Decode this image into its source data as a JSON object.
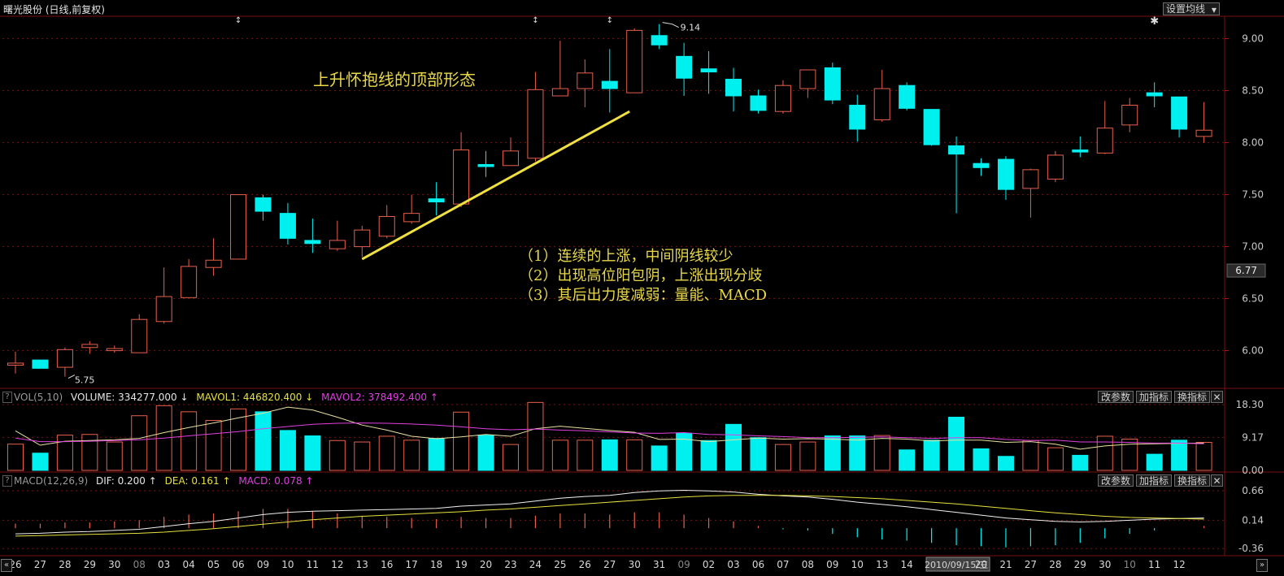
{
  "header": {
    "title": "曙光股份 (日线,前复权)",
    "setting_button": "设置均线",
    "setting_caret": "▼"
  },
  "annotations": {
    "title": "上升怀抱线的顶部形态",
    "notes": [
      "（1）连续的上涨，中间阴线较少",
      "（2）出现高位阳包阴，上涨出现分歧",
      "（3）其后出力度减弱：量能、MACD"
    ]
  },
  "markers": {
    "high_label": "9.14",
    "low_label": "5.75",
    "current_price": "6.77",
    "date_highlight": "2010/09/15/三"
  },
  "vol_panel": {
    "q": "?",
    "name": "VOL(5,10)",
    "volume": "VOLUME: 334277.000",
    "volume_arrow": "↓",
    "mavol1": "MAVOL1: 446820.400",
    "mavol1_arrow": "↓",
    "mavol2": "MAVOL2: 378492.400",
    "mavol2_arrow": "↑",
    "btn_params": "改参数",
    "btn_add": "加指标",
    "btn_switch": "换指标",
    "btn_close": "✕"
  },
  "macd_panel": {
    "q": "?",
    "name": "MACD(12,26,9)",
    "dif": "DIF: 0.200",
    "dif_arrow": "↑",
    "dea": "DEA: 0.161",
    "dea_arrow": "↑",
    "macd": "MACD: 0.078",
    "macd_arrow": "↑",
    "btn_params": "改参数",
    "btn_add": "加指标",
    "btn_switch": "换指标",
    "btn_close": "✕"
  },
  "colors": {
    "up": "#e8604c",
    "down": "#00f0f0",
    "trend": "#f0e040",
    "ma1": "#e8e0a0",
    "ma2": "#e040e0",
    "dif": "#f0f0f0",
    "dea": "#e8e040",
    "grid": "#7a1010"
  },
  "chart_data": {
    "type": "candlestick",
    "price_axis": {
      "ticks": [
        "9.00",
        "8.50",
        "8.00",
        "7.50",
        "7.00",
        "6.50",
        "6.00"
      ],
      "range": [
        5.7,
        9.2
      ]
    },
    "x_labels": [
      "26",
      "27",
      "28",
      "29",
      "30",
      "08",
      "03",
      "04",
      "05",
      "06",
      "09",
      "10",
      "11",
      "12",
      "13",
      "16",
      "17",
      "18",
      "19",
      "20",
      "23",
      "24",
      "25",
      "26",
      "27",
      "30",
      "31",
      "09",
      "02",
      "03",
      "06",
      "07",
      "08",
      "09",
      "10",
      "13",
      "14",
      "15",
      "2010/09/15/三",
      "20",
      "21",
      "27",
      "28",
      "29",
      "30",
      "10",
      "11",
      "12"
    ],
    "candles": [
      {
        "o": 5.86,
        "c": 5.88,
        "h": 5.99,
        "l": 5.78
      },
      {
        "o": 5.91,
        "c": 5.83,
        "h": 5.91,
        "l": 5.83
      },
      {
        "o": 5.84,
        "c": 6.01,
        "h": 6.03,
        "l": 5.75
      },
      {
        "o": 6.03,
        "c": 6.06,
        "h": 6.09,
        "l": 5.97
      },
      {
        "o": 6.0,
        "c": 6.02,
        "h": 6.05,
        "l": 5.98
      },
      {
        "o": 5.98,
        "c": 6.3,
        "h": 6.35,
        "l": 5.98
      },
      {
        "o": 6.28,
        "c": 6.52,
        "h": 6.8,
        "l": 6.26
      },
      {
        "o": 6.51,
        "c": 6.81,
        "h": 6.88,
        "l": 6.51
      },
      {
        "o": 6.8,
        "c": 6.87,
        "h": 7.08,
        "l": 6.72
      },
      {
        "o": 6.88,
        "c": 7.5,
        "h": 7.5,
        "l": 6.88
      },
      {
        "o": 7.47,
        "c": 7.34,
        "h": 7.5,
        "l": 7.25
      },
      {
        "o": 7.32,
        "c": 7.08,
        "h": 7.42,
        "l": 7.02
      },
      {
        "o": 7.06,
        "c": 7.03,
        "h": 7.27,
        "l": 6.94
      },
      {
        "o": 6.98,
        "c": 7.06,
        "h": 7.25,
        "l": 6.96
      },
      {
        "o": 7.0,
        "c": 7.16,
        "h": 7.2,
        "l": 6.9
      },
      {
        "o": 7.1,
        "c": 7.29,
        "h": 7.4,
        "l": 7.08
      },
      {
        "o": 7.24,
        "c": 7.32,
        "h": 7.5,
        "l": 7.22
      },
      {
        "o": 7.46,
        "c": 7.43,
        "h": 7.62,
        "l": 7.3
      },
      {
        "o": 7.41,
        "c": 7.93,
        "h": 8.1,
        "l": 7.38
      },
      {
        "o": 7.79,
        "c": 7.77,
        "h": 7.92,
        "l": 7.67
      },
      {
        "o": 7.78,
        "c": 7.92,
        "h": 8.05,
        "l": 7.78
      },
      {
        "o": 7.85,
        "c": 8.51,
        "h": 8.68,
        "l": 7.82
      },
      {
        "o": 8.45,
        "c": 8.52,
        "h": 8.98,
        "l": 8.45
      },
      {
        "o": 8.52,
        "c": 8.67,
        "h": 8.8,
        "l": 8.34
      },
      {
        "o": 8.59,
        "c": 8.52,
        "h": 8.9,
        "l": 8.29
      },
      {
        "o": 8.48,
        "c": 9.08,
        "h": 9.1,
        "l": 8.48
      },
      {
        "o": 9.03,
        "c": 8.94,
        "h": 9.14,
        "l": 8.9
      },
      {
        "o": 8.83,
        "c": 8.62,
        "h": 8.96,
        "l": 8.45
      },
      {
        "o": 8.71,
        "c": 8.68,
        "h": 8.88,
        "l": 8.47
      },
      {
        "o": 8.61,
        "c": 8.45,
        "h": 8.72,
        "l": 8.3
      },
      {
        "o": 8.45,
        "c": 8.31,
        "h": 8.51,
        "l": 8.28
      },
      {
        "o": 8.3,
        "c": 8.55,
        "h": 8.6,
        "l": 8.28
      },
      {
        "o": 8.52,
        "c": 8.7,
        "h": 8.7,
        "l": 8.43
      },
      {
        "o": 8.72,
        "c": 8.41,
        "h": 8.77,
        "l": 8.37
      },
      {
        "o": 8.36,
        "c": 8.13,
        "h": 8.46,
        "l": 8.01
      },
      {
        "o": 8.22,
        "c": 8.52,
        "h": 8.7,
        "l": 8.2
      },
      {
        "o": 8.55,
        "c": 8.33,
        "h": 8.58,
        "l": 8.31
      },
      {
        "o": 8.32,
        "c": 7.98,
        "h": 8.32,
        "l": 7.97
      },
      {
        "o": 7.97,
        "c": 7.89,
        "h": 8.06,
        "l": 7.32
      },
      {
        "o": 7.8,
        "c": 7.76,
        "h": 7.85,
        "l": 7.68
      },
      {
        "o": 7.84,
        "c": 7.55,
        "h": 7.87,
        "l": 7.45
      },
      {
        "o": 7.56,
        "c": 7.74,
        "h": 7.75,
        "l": 7.28
      },
      {
        "o": 7.65,
        "c": 7.88,
        "h": 7.92,
        "l": 7.62
      },
      {
        "o": 7.93,
        "c": 7.91,
        "h": 8.06,
        "l": 7.86
      },
      {
        "o": 7.9,
        "c": 8.14,
        "h": 8.4,
        "l": 7.89
      },
      {
        "o": 8.17,
        "c": 8.36,
        "h": 8.43,
        "l": 8.1
      },
      {
        "o": 8.48,
        "c": 8.45,
        "h": 8.58,
        "l": 8.34
      },
      {
        "o": 8.44,
        "c": 8.13,
        "h": 8.44,
        "l": 8.05
      },
      {
        "o": 8.06,
        "c": 8.12,
        "h": 8.39,
        "l": 8.0
      }
    ],
    "volume_axis": {
      "ticks": [
        "18.30",
        "9.17",
        "0.00"
      ],
      "range": [
        0,
        18.3
      ]
    },
    "volume": [
      7.3,
      4.8,
      9.8,
      10.0,
      7.9,
      15.2,
      18.0,
      16.3,
      13.9,
      17.1,
      16.3,
      11.1,
      9.6,
      8.3,
      7.9,
      9.5,
      8.4,
      8.9,
      16.2,
      9.8,
      7.2,
      18.9,
      8.4,
      8.4,
      8.5,
      8.5,
      6.8,
      10.3,
      8.3,
      12.8,
      9.1,
      7.2,
      7.9,
      9.6,
      9.6,
      9.7,
      5.7,
      8.4,
      14.8,
      6.0,
      3.9,
      8.3,
      6.3,
      4.2,
      9.5,
      8.7,
      4.5,
      8.4,
      7.8
    ],
    "ma_vol1": [
      11.0,
      7.0,
      8.1,
      8.3,
      8.5,
      8.9,
      10.5,
      11.9,
      13.2,
      14.6,
      15.9,
      17.6,
      16.8,
      14.8,
      12.6,
      11.2,
      9.5,
      8.8,
      9.3,
      10.0,
      9.5,
      11.6,
      12.3,
      11.7,
      11.1,
      10.6,
      8.6,
      8.7,
      8.0,
      8.5,
      9.0,
      8.7,
      8.8,
      8.7,
      8.4,
      8.9,
      8.7,
      8.2,
      8.4,
      8.4,
      7.8,
      8.0,
      7.3,
      5.9,
      6.8,
      7.3,
      7.4,
      7.5,
      7.6
    ],
    "ma_vol2": [
      9.0,
      8.0,
      8.0,
      8.1,
      8.3,
      8.5,
      9.0,
      9.6,
      10.2,
      10.8,
      11.6,
      12.2,
      12.8,
      13.1,
      13.2,
      13.1,
      12.9,
      12.6,
      12.1,
      11.6,
      11.3,
      11.5,
      11.2,
      11.0,
      10.7,
      10.4,
      10.3,
      10.5,
      10.0,
      9.9,
      9.6,
      9.4,
      9.1,
      9.1,
      9.2,
      9.3,
      9.1,
      8.9,
      9.1,
      9.1,
      8.6,
      8.3,
      8.4,
      7.9,
      7.9,
      7.8,
      7.6,
      7.6,
      7.4
    ],
    "macd_axis": {
      "ticks": [
        "0.66",
        "0.14",
        "-0.36"
      ],
      "range": [
        -0.4,
        0.72
      ]
    },
    "dif": [
      -0.1,
      -0.09,
      -0.07,
      -0.06,
      -0.04,
      -0.02,
      0.03,
      0.08,
      0.12,
      0.18,
      0.24,
      0.28,
      0.3,
      0.31,
      0.32,
      0.33,
      0.34,
      0.35,
      0.39,
      0.41,
      0.43,
      0.48,
      0.53,
      0.56,
      0.58,
      0.63,
      0.66,
      0.67,
      0.66,
      0.64,
      0.6,
      0.57,
      0.55,
      0.51,
      0.46,
      0.42,
      0.38,
      0.33,
      0.28,
      0.23,
      0.18,
      0.15,
      0.12,
      0.11,
      0.12,
      0.14,
      0.16,
      0.17,
      0.18
    ],
    "dea": [
      -0.14,
      -0.13,
      -0.12,
      -0.11,
      -0.1,
      -0.09,
      -0.07,
      -0.04,
      -0.01,
      0.03,
      0.07,
      0.11,
      0.15,
      0.18,
      0.21,
      0.23,
      0.25,
      0.27,
      0.29,
      0.32,
      0.34,
      0.37,
      0.4,
      0.43,
      0.46,
      0.49,
      0.52,
      0.55,
      0.57,
      0.58,
      0.58,
      0.58,
      0.57,
      0.56,
      0.54,
      0.52,
      0.49,
      0.46,
      0.43,
      0.39,
      0.35,
      0.31,
      0.27,
      0.24,
      0.21,
      0.19,
      0.18,
      0.17,
      0.16
    ],
    "macd": [
      0.08,
      0.08,
      0.1,
      0.1,
      0.12,
      0.14,
      0.2,
      0.24,
      0.26,
      0.3,
      0.34,
      0.34,
      0.3,
      0.26,
      0.22,
      0.2,
      0.18,
      0.16,
      0.2,
      0.18,
      0.18,
      0.22,
      0.26,
      0.26,
      0.24,
      0.28,
      0.28,
      0.24,
      0.18,
      0.12,
      0.04,
      -0.02,
      -0.04,
      -0.1,
      -0.16,
      -0.2,
      -0.22,
      -0.26,
      -0.3,
      -0.32,
      -0.34,
      -0.32,
      -0.3,
      -0.26,
      -0.18,
      -0.1,
      -0.04,
      0.0,
      0.04
    ]
  }
}
